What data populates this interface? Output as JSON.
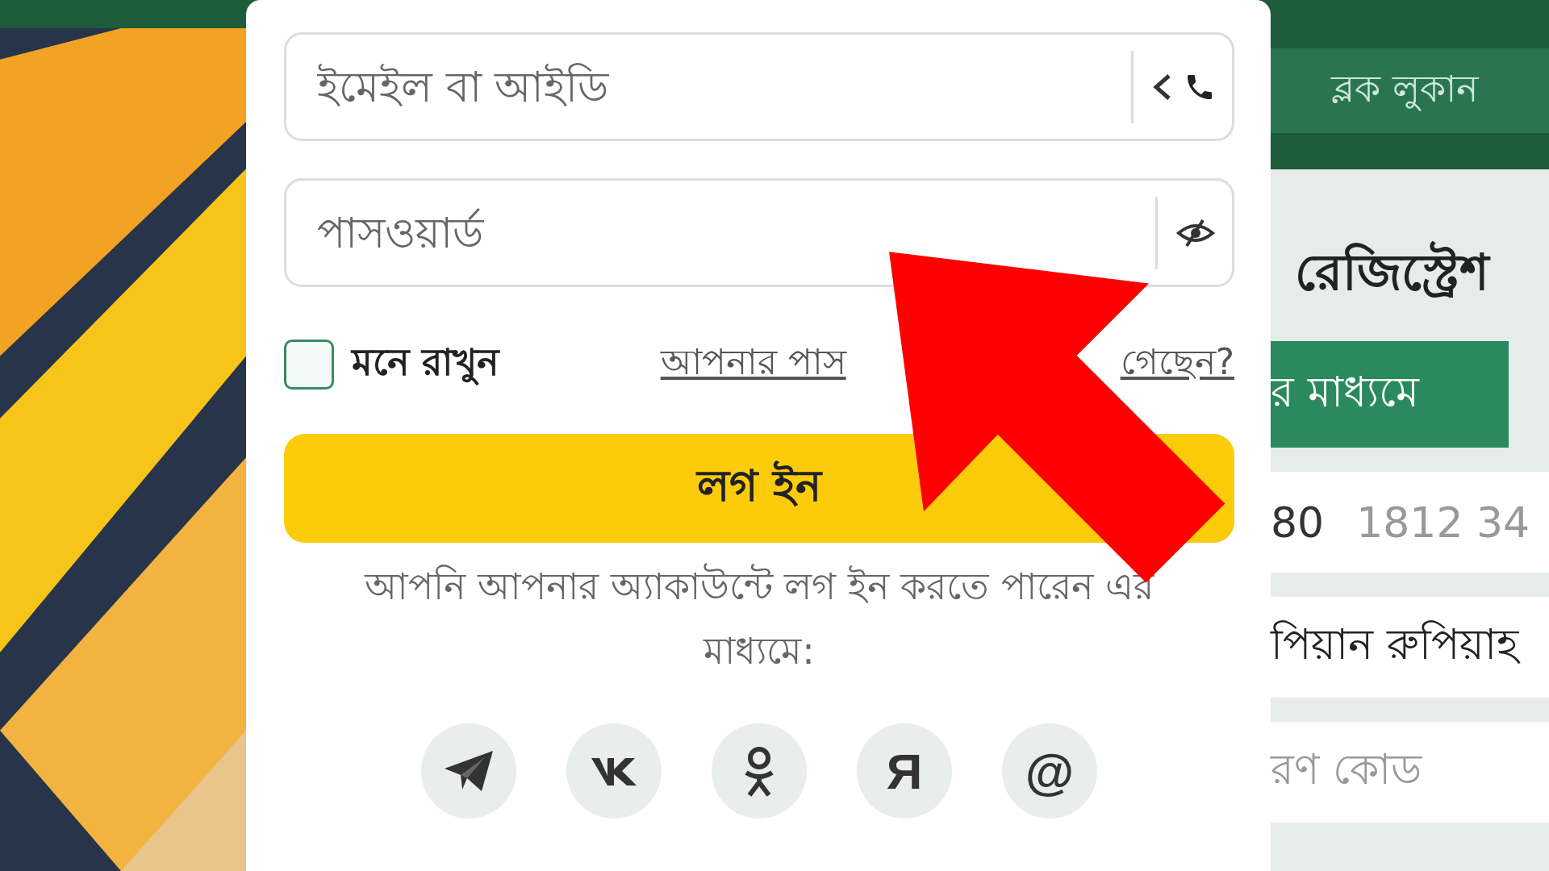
{
  "login_form": {
    "email": {
      "placeholder": "ইমেইল বা আইডি"
    },
    "password": {
      "placeholder": "পাসওয়ার্ড"
    },
    "remember": {
      "label": "মনে রাখুন",
      "checked": false
    },
    "forgot_link": [
      "আপনার পাস",
      "গেছেন?"
    ],
    "login_button": "লগ ইন",
    "social_text": "আপনি আপনার অ্যাকাউন্টে লগ ইন করতে পারেন এর মাধ্যমে:",
    "social_buttons": [
      {
        "kind": "telegram"
      },
      {
        "kind": "vk"
      },
      {
        "kind": "ok"
      },
      {
        "kind": "glyph",
        "glyph": "Я"
      },
      {
        "kind": "glyph",
        "glyph": "@"
      }
    ]
  },
  "registration_panel": {
    "hide_block": "ব্লক লুকান",
    "title": "রেজিস্ট্রেশ",
    "tab": "র মাধ্যমে",
    "phone_code": "80",
    "phone_placeholder": "1812 34",
    "currency": "পিয়ান রুপিয়াহ",
    "promo_placeholder": "রণ কোড"
  }
}
